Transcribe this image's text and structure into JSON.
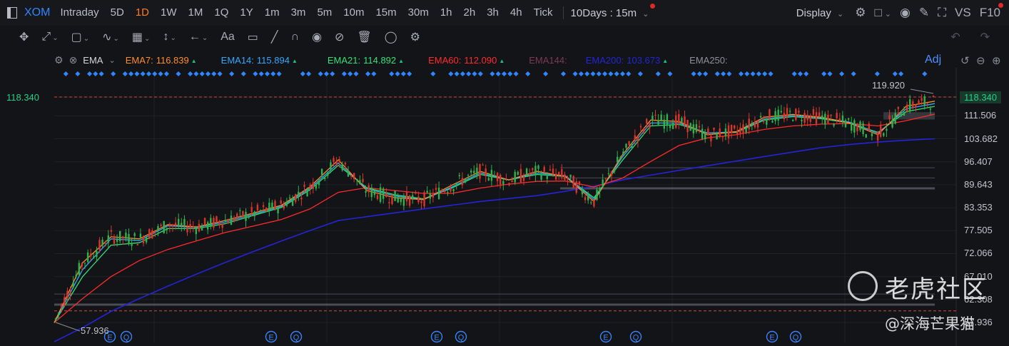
{
  "header": {
    "ticker": "XOM",
    "timeframes": [
      "Intraday",
      "5D",
      "1D",
      "1W",
      "1M",
      "1Q",
      "1Y",
      "1m",
      "3m",
      "5m",
      "10m",
      "15m",
      "30m",
      "1h",
      "2h",
      "3h",
      "4h",
      "Tick"
    ],
    "active_timeframe": "1D",
    "range_select": "10Days : 15m",
    "display_label": "Display",
    "vs_label": "VS",
    "f10_label": "F10"
  },
  "legend": {
    "indicator": "EMA",
    "emas": [
      {
        "label": "EMA7:",
        "value": "116.839",
        "color": "#ff8c2a",
        "arrow": true
      },
      {
        "label": "EMA14:",
        "value": "115.894",
        "color": "#35a7ff",
        "arrow": true
      },
      {
        "label": "EMA21:",
        "value": "114.892",
        "color": "#33e07a",
        "arrow": true
      },
      {
        "label": "EMA60:",
        "value": "112.090",
        "color": "#ff2a2a",
        "arrow": true
      },
      {
        "label": "EMA144:",
        "value": "",
        "color": "#7a3a52",
        "arrow": false
      },
      {
        "label": "EMA200:",
        "value": "103.673",
        "color": "#2424d8",
        "arrow": true
      },
      {
        "label": "EMA250:",
        "value": "",
        "color": "#8d9096",
        "arrow": false
      }
    ],
    "adj_label": "Adj"
  },
  "price": {
    "current": "118.340",
    "high_label": "119.920",
    "low_label": "57.936"
  },
  "chart_data": {
    "type": "candlestick",
    "y_ticks": [
      "118.340",
      "111.506",
      "103.682",
      "96.407",
      "89.643",
      "83.353",
      "77.505",
      "72.066",
      "67.010",
      "62.308",
      "57.936"
    ],
    "ylim": [
      57.936,
      118.34
    ],
    "y_scale": "log",
    "series": [
      {
        "name": "EMA7",
        "color": "#ff8c2a",
        "values": [
          57.9,
          70,
          76,
          75.5,
          79,
          78.4,
          80,
          81.9,
          84,
          89,
          97,
          88,
          86,
          85.5,
          89.5,
          93.5,
          91,
          93.5,
          92,
          85,
          98.5,
          110,
          109.5,
          105,
          106,
          111,
          112,
          111,
          109,
          105,
          115,
          116.8
        ]
      },
      {
        "name": "EMA14",
        "color": "#35a7ff",
        "values": [
          57.9,
          68.5,
          75.5,
          75.1,
          78.7,
          78.3,
          79.6,
          81.6,
          83.7,
          88.6,
          96,
          88.5,
          86.5,
          85.5,
          89,
          93,
          91,
          93,
          92.2,
          85.5,
          97.8,
          109,
          109,
          105.5,
          106,
          110.4,
          111.6,
          110.8,
          109.3,
          105.5,
          114,
          115.9
        ]
      },
      {
        "name": "EMA21",
        "color": "#33e07a",
        "values": [
          57.9,
          67,
          74,
          74.6,
          78,
          78,
          79.2,
          81.3,
          83.4,
          88.2,
          95.3,
          88.8,
          86.8,
          85.7,
          88.7,
          92.6,
          91,
          92.6,
          92,
          86,
          96.8,
          108,
          108.5,
          105.6,
          105.8,
          110,
          111.2,
          110.5,
          109,
          105.8,
          113,
          114.9
        ]
      },
      {
        "name": "EMA60",
        "color": "#ff2a2a",
        "values": [
          57.9,
          62.5,
          67,
          70.5,
          73,
          75,
          77,
          78.6,
          80.3,
          83,
          87.5,
          88.8,
          88,
          87.2,
          87.2,
          88.7,
          89.8,
          90.6,
          90.7,
          89,
          91.5,
          96.5,
          101.5,
          104,
          105,
          106.8,
          108,
          108.6,
          108.8,
          108,
          109.8,
          112.1
        ]
      },
      {
        "name": "EMA200",
        "color": "#2424d8",
        "values": [
          54.5,
          57,
          60,
          62.5,
          65,
          67.5,
          70,
          72.5,
          75,
          77.5,
          80,
          81,
          82,
          83,
          84,
          85,
          85.8,
          86.6,
          87.8,
          89.2,
          91,
          92.4,
          93.8,
          95.2,
          96.6,
          98,
          99.4,
          100.8,
          101.8,
          102.6,
          103.2,
          103.673
        ]
      }
    ]
  },
  "watermark": {
    "main": "老虎社区",
    "sub": "@深海芒果猫"
  }
}
